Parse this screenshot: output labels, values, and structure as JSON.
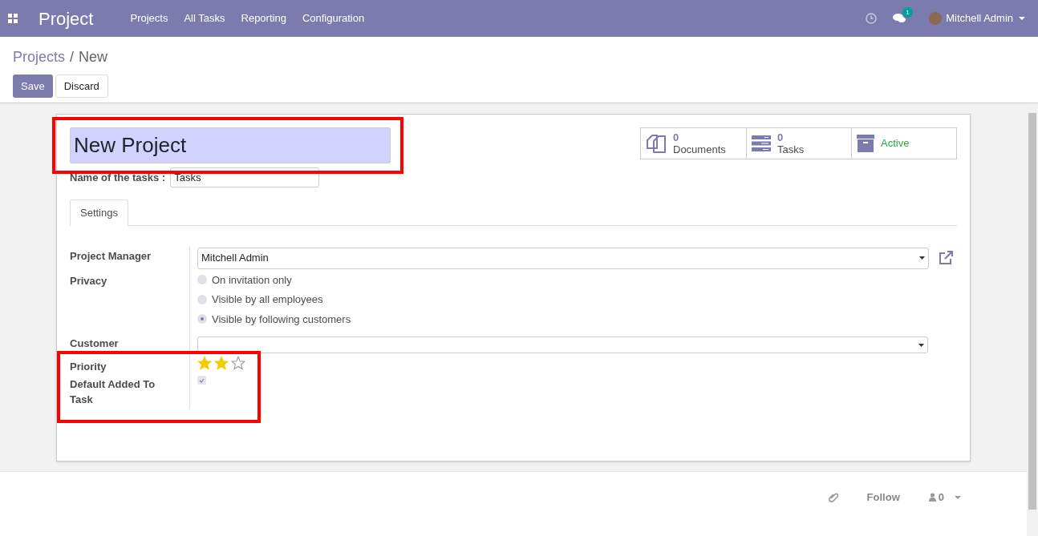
{
  "navbar": {
    "app_title": "Project",
    "menu": [
      "Projects",
      "All Tasks",
      "Reporting",
      "Configuration"
    ],
    "message_count": "1",
    "user": "Mitchell Admin"
  },
  "breadcrumb": {
    "parent": "Projects",
    "separator": "/",
    "current": "New"
  },
  "buttons": {
    "save": "Save",
    "discard": "Discard"
  },
  "form": {
    "name": "New Project",
    "tasks_label": "Name of the tasks :",
    "tasks_value": "Tasks",
    "smart_buttons": [
      {
        "kind": "documents",
        "count": "0",
        "label": "Documents"
      },
      {
        "kind": "tasks",
        "count": "0",
        "label": "Tasks"
      },
      {
        "kind": "archive",
        "label": "Active"
      }
    ],
    "tabs": [
      {
        "label": "Settings",
        "selected": true
      }
    ],
    "project_manager": {
      "label": "Project Manager",
      "value": "Mitchell Admin"
    },
    "privacy": {
      "label": "Privacy",
      "options": [
        {
          "label": "On invitation only",
          "selected": false
        },
        {
          "label": "Visible by all employees",
          "selected": false
        },
        {
          "label": "Visible by following customers",
          "selected": true
        }
      ]
    },
    "customer": {
      "label": "Customer"
    },
    "priority": {
      "label": "Priority",
      "stars": 2
    },
    "default_added": {
      "label": "Default Added To Task",
      "checked": true
    }
  },
  "chatter": {
    "follow": "Follow",
    "followers": "0"
  }
}
